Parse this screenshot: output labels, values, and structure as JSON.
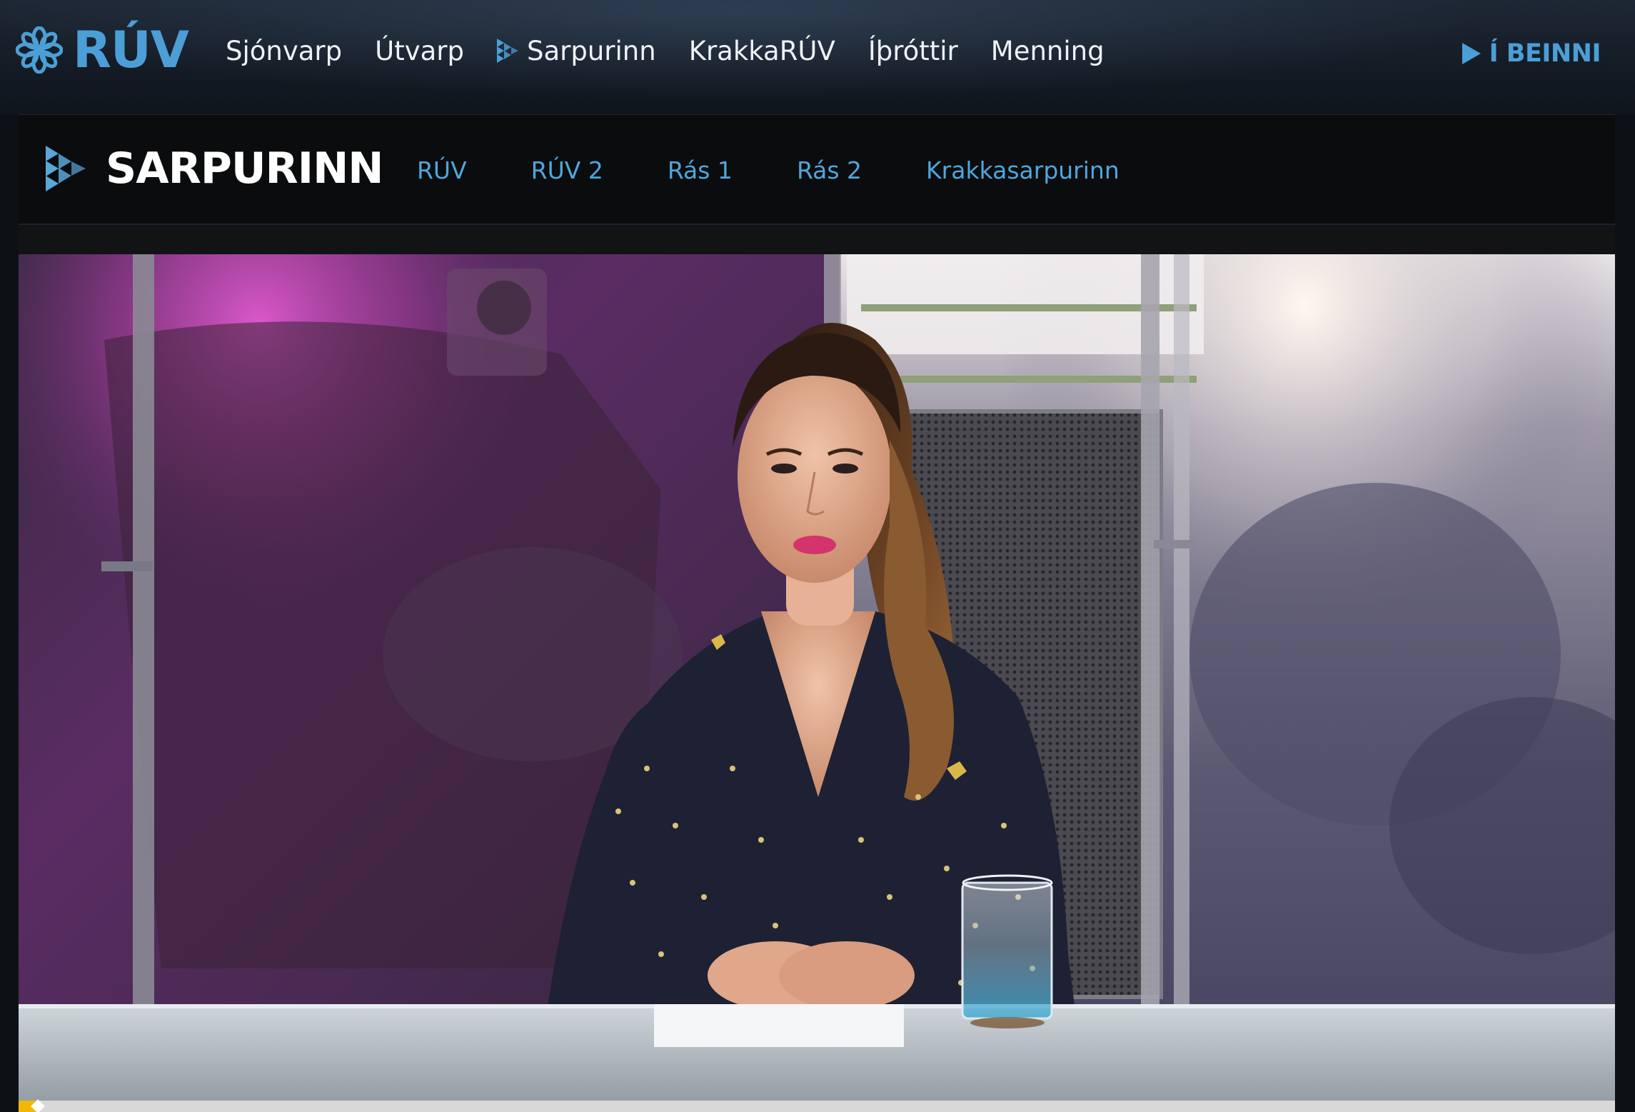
{
  "site": {
    "logo_text": "RÚV",
    "logo_icon": "ruv-flower-icon",
    "brand_color": "#4b9fd6"
  },
  "main_nav": {
    "items": [
      {
        "label": "Sjónvarp"
      },
      {
        "label": "Útvarp"
      },
      {
        "label": "Sarpurinn",
        "icon": "sarpurinn-play-icon"
      },
      {
        "label": "KrakkaRÚV"
      },
      {
        "label": "Íþróttir"
      },
      {
        "label": "Menning"
      }
    ],
    "live": {
      "label": "Í BEINNI",
      "icon": "play-icon"
    }
  },
  "sarpurinn": {
    "title": "SARPURINN",
    "logo_icon": "sarpurinn-triangles-icon",
    "tabs": [
      {
        "label": "RÚV"
      },
      {
        "label": "RÚV 2"
      },
      {
        "label": "Rás 1"
      },
      {
        "label": "Rás 2"
      },
      {
        "label": "Krakkasarpurinn"
      }
    ],
    "link_color": "#4ea7de"
  },
  "player": {
    "progress_fraction": 0.012,
    "progress_color": "#f2b705",
    "scene": "news-presenter-studio"
  }
}
